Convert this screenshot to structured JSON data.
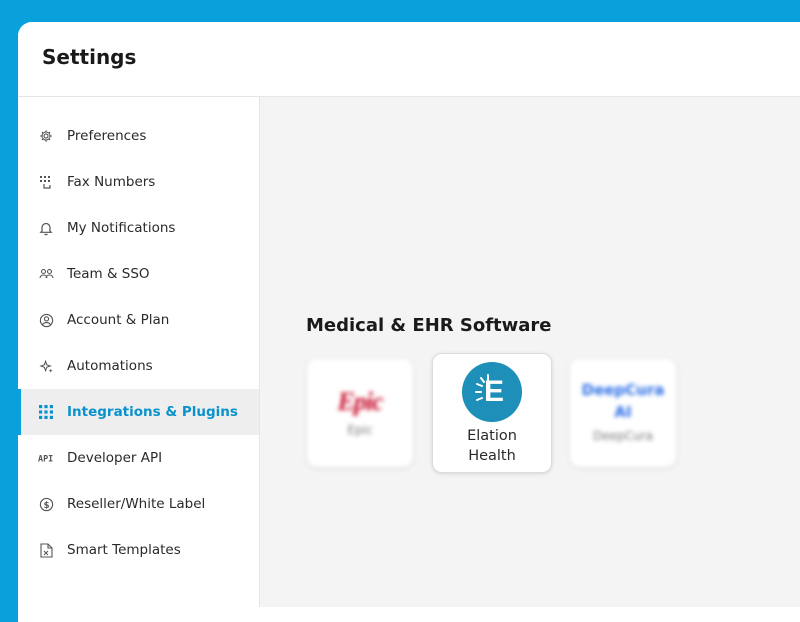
{
  "header": {
    "title": "Settings"
  },
  "sidebar": {
    "items": [
      {
        "label": "Preferences",
        "icon": "gear-icon"
      },
      {
        "label": "Fax Numbers",
        "icon": "fax-keypad-icon"
      },
      {
        "label": "My Notifications",
        "icon": "bell-icon"
      },
      {
        "label": "Team & SSO",
        "icon": "team-icon"
      },
      {
        "label": "Account & Plan",
        "icon": "user-circle-icon"
      },
      {
        "label": "Automations",
        "icon": "sparkle-icon"
      },
      {
        "label": "Integrations & Plugins",
        "icon": "grid-icon",
        "active": true
      },
      {
        "label": "Developer API",
        "icon": "api-icon"
      },
      {
        "label": "Reseller/White Label",
        "icon": "dollar-circle-icon"
      },
      {
        "label": "Smart Templates",
        "icon": "document-icon"
      }
    ]
  },
  "main": {
    "section_title": "Medical & EHR Software",
    "cards": {
      "epic": {
        "logo_text": "Epic",
        "name": "Epic"
      },
      "elation": {
        "logo_letter": "E",
        "name_line1": "Elation",
        "name_line2": "Health"
      },
      "deepcura": {
        "logo_line1": "DeepCura",
        "logo_line2": "AI",
        "name": "DeepCura"
      }
    }
  },
  "colors": {
    "accent": "#0aa0dc",
    "active_text": "#0a92cc",
    "epic_red": "#c8102e",
    "elation_blue": "#1e8fb8",
    "deepcura_blue": "#2b6de6"
  }
}
